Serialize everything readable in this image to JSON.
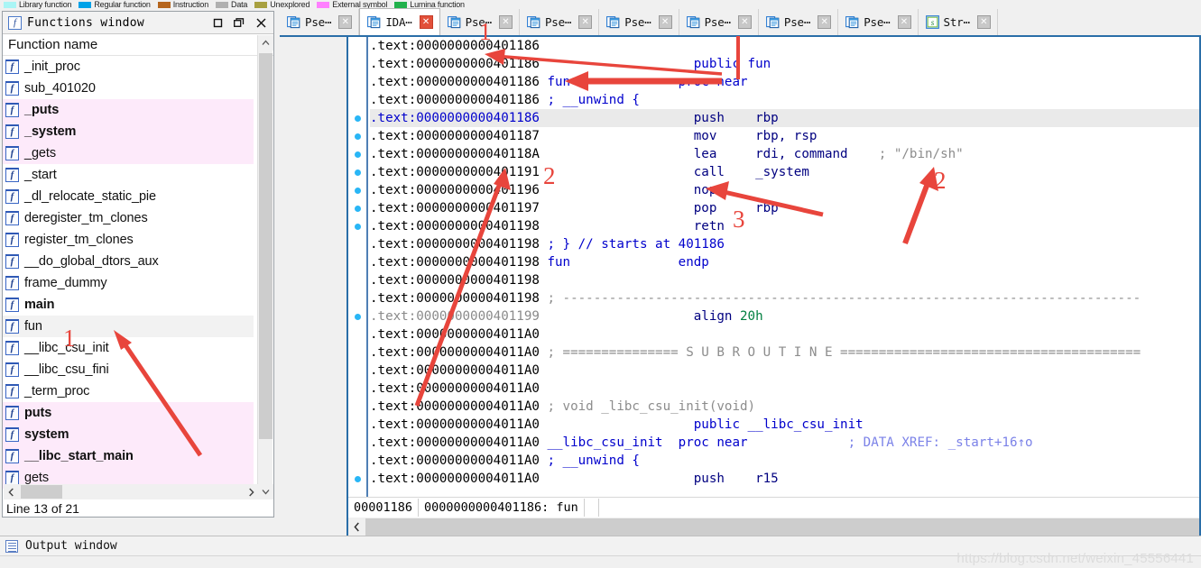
{
  "navigator_legend": [
    {
      "label": "Library function",
      "color": "#aaf5f5"
    },
    {
      "label": "Regular function",
      "color": "#00a2e8"
    },
    {
      "label": "Instruction",
      "color": "#b5651d"
    },
    {
      "label": "Data",
      "color": "#b0b0b0"
    },
    {
      "label": "Unexplored",
      "color": "#a8a040"
    },
    {
      "label": "External symbol",
      "color": "#ff80ff"
    },
    {
      "label": "Lumina function",
      "color": "#22b14c"
    }
  ],
  "functions_window": {
    "title": "Functions window",
    "title_icon": "function-f-icon",
    "column_header": "Function name",
    "status": "Line 13 of 21",
    "window_buttons": [
      "maximize",
      "restore",
      "close"
    ],
    "items": [
      {
        "name": "_init_proc",
        "highlight": "none",
        "bold": false
      },
      {
        "name": "sub_401020",
        "highlight": "none",
        "bold": false
      },
      {
        "name": "_puts",
        "highlight": "pink",
        "bold": true
      },
      {
        "name": "_system",
        "highlight": "pink",
        "bold": true
      },
      {
        "name": "_gets",
        "highlight": "pink",
        "bold": false
      },
      {
        "name": "_start",
        "highlight": "none",
        "bold": false
      },
      {
        "name": "_dl_relocate_static_pie",
        "highlight": "none",
        "bold": false
      },
      {
        "name": "deregister_tm_clones",
        "highlight": "none",
        "bold": false
      },
      {
        "name": "register_tm_clones",
        "highlight": "none",
        "bold": false
      },
      {
        "name": "__do_global_dtors_aux",
        "highlight": "none",
        "bold": false
      },
      {
        "name": "frame_dummy",
        "highlight": "none",
        "bold": false
      },
      {
        "name": "main",
        "highlight": "none",
        "bold": true
      },
      {
        "name": "fun",
        "highlight": "sel",
        "bold": false
      },
      {
        "name": "__libc_csu_init",
        "highlight": "none",
        "bold": false
      },
      {
        "name": "__libc_csu_fini",
        "highlight": "none",
        "bold": false
      },
      {
        "name": "_term_proc",
        "highlight": "none",
        "bold": false
      },
      {
        "name": "puts",
        "highlight": "pink",
        "bold": true
      },
      {
        "name": "system",
        "highlight": "pink",
        "bold": true
      },
      {
        "name": "__libc_start_main",
        "highlight": "pink",
        "bold": true
      },
      {
        "name": "gets",
        "highlight": "pink",
        "bold": false
      }
    ]
  },
  "tabs": [
    {
      "label": "Pse⋯",
      "icon": "pseudocode-icon",
      "active": false
    },
    {
      "label": "IDA⋯",
      "icon": "ida-view-icon",
      "active": true
    },
    {
      "label": "Pse⋯",
      "icon": "pseudocode-icon",
      "active": false
    },
    {
      "label": "Pse⋯",
      "icon": "pseudocode-icon",
      "active": false
    },
    {
      "label": "Pse⋯",
      "icon": "pseudocode-icon",
      "active": false
    },
    {
      "label": "Pse⋯",
      "icon": "pseudocode-icon",
      "active": false
    },
    {
      "label": "Pse⋯",
      "icon": "pseudocode-icon",
      "active": false
    },
    {
      "label": "Pse⋯",
      "icon": "pseudocode-icon",
      "active": false
    },
    {
      "label": "Str⋯",
      "icon": "strings-icon",
      "active": false
    }
  ],
  "disassembly": {
    "lines": [
      {
        "dot": false,
        "hl": false,
        "addr": "",
        "addr_style": "normal",
        "segment": ".text:0000000000401186",
        "label": "",
        "body": ""
      },
      {
        "dot": false,
        "hl": false,
        "segment": ".text:0000000000401186",
        "label": "",
        "body": "                    public fun",
        "body_style": "kw"
      },
      {
        "dot": false,
        "hl": false,
        "segment": ".text:0000000000401186",
        "label": "fun",
        "body": "              proc near",
        "body_style": "kw"
      },
      {
        "dot": false,
        "hl": false,
        "segment": ".text:0000000000401186",
        "label": "; __unwind {",
        "body": "",
        "body_style": "kw"
      },
      {
        "dot": true,
        "hl": true,
        "segment": ".text:0000000000401186",
        "label": "",
        "body": "                    push    rbp",
        "body_style": "ins",
        "addr_style": "blue"
      },
      {
        "dot": true,
        "hl": false,
        "segment": ".text:0000000000401187",
        "label": "",
        "body": "                    mov     rbp, rsp",
        "body_style": "ins"
      },
      {
        "dot": true,
        "hl": false,
        "segment": ".text:000000000040118A",
        "label": "",
        "body": "                    lea     rdi, command    ; \"/bin/sh\"",
        "body_style": "ins"
      },
      {
        "dot": true,
        "hl": false,
        "segment": ".text:0000000000401191",
        "label": "",
        "body": "                    call    _system",
        "body_style": "ins"
      },
      {
        "dot": true,
        "hl": false,
        "segment": ".text:0000000000401196",
        "label": "",
        "body": "                    nop",
        "body_style": "ins"
      },
      {
        "dot": true,
        "hl": false,
        "segment": ".text:0000000000401197",
        "label": "",
        "body": "                    pop     rbp",
        "body_style": "ins"
      },
      {
        "dot": true,
        "hl": false,
        "segment": ".text:0000000000401198",
        "label": "",
        "body": "                    retn",
        "body_style": "ins"
      },
      {
        "dot": false,
        "hl": false,
        "segment": ".text:0000000000401198",
        "label": "; } // starts at 401186",
        "body": "",
        "body_style": "kw"
      },
      {
        "dot": false,
        "hl": false,
        "segment": ".text:0000000000401198",
        "label": "fun",
        "body": "              endp",
        "body_style": "kw"
      },
      {
        "dot": false,
        "hl": false,
        "segment": ".text:0000000000401198",
        "label": "",
        "body": ""
      },
      {
        "dot": false,
        "hl": false,
        "segment": ".text:0000000000401198",
        "label": "; ---------------------------------------------------------------------------",
        "body": "",
        "body_style": "cmt"
      },
      {
        "dot": true,
        "hl": false,
        "segment": ".text:0000000000401199",
        "label": "",
        "body": "                    align 20h",
        "body_style": "align",
        "addr_style": "gray"
      },
      {
        "dot": false,
        "hl": false,
        "segment": ".text:00000000004011A0",
        "label": "",
        "body": ""
      },
      {
        "dot": false,
        "hl": false,
        "segment": ".text:00000000004011A0",
        "label": "; =============== S U B R O U T I N E =======================================",
        "body": "",
        "body_style": "cmt"
      },
      {
        "dot": false,
        "hl": false,
        "segment": ".text:00000000004011A0",
        "label": "",
        "body": ""
      },
      {
        "dot": false,
        "hl": false,
        "segment": ".text:00000000004011A0",
        "label": "",
        "body": ""
      },
      {
        "dot": false,
        "hl": false,
        "segment": ".text:00000000004011A0",
        "label": "; void _libc_csu_init(void)",
        "body": "",
        "body_style": "cmt"
      },
      {
        "dot": false,
        "hl": false,
        "segment": ".text:00000000004011A0",
        "label": "",
        "body": "                    public __libc_csu_init",
        "body_style": "kw"
      },
      {
        "dot": false,
        "hl": false,
        "segment": ".text:00000000004011A0",
        "label": "__libc_csu_init",
        "body": "  proc near             ; DATA XREF: _start+16↑o",
        "body_style": "kwxref"
      },
      {
        "dot": false,
        "hl": false,
        "segment": ".text:00000000004011A0",
        "label": "; __unwind {",
        "body": "",
        "body_style": "kw"
      },
      {
        "dot": true,
        "hl": false,
        "segment": ".text:00000000004011A0",
        "label": "",
        "body": "                    push    r15",
        "body_style": "ins"
      }
    ],
    "status_bar": {
      "file_offset": "00001186",
      "location": "0000000000401186: fun"
    }
  },
  "output_window": {
    "title": "Output window",
    "icon": "output-list-icon"
  },
  "watermark": "https://blog.csdn.net/weixin_45556441",
  "annotations": [
    {
      "number": "1",
      "kind": "arrow-to-fun-in-list"
    },
    {
      "number": "1",
      "kind": "arrow-to-public-fun"
    },
    {
      "number": "2",
      "kind": "arrow-to-fun-proc"
    },
    {
      "number": "2",
      "kind": "arrow-to-bin-sh"
    },
    {
      "number": "3",
      "kind": "arrow-to-nop"
    }
  ],
  "colors": {
    "accent_blue": "#2a6ea8",
    "pink_highlight": "#fdeafa",
    "annotation_red": "#e8453c",
    "keyword_blue": "#0000cc",
    "comment_gray": "#8c8c8c",
    "xref_purple": "#7b82e8"
  }
}
